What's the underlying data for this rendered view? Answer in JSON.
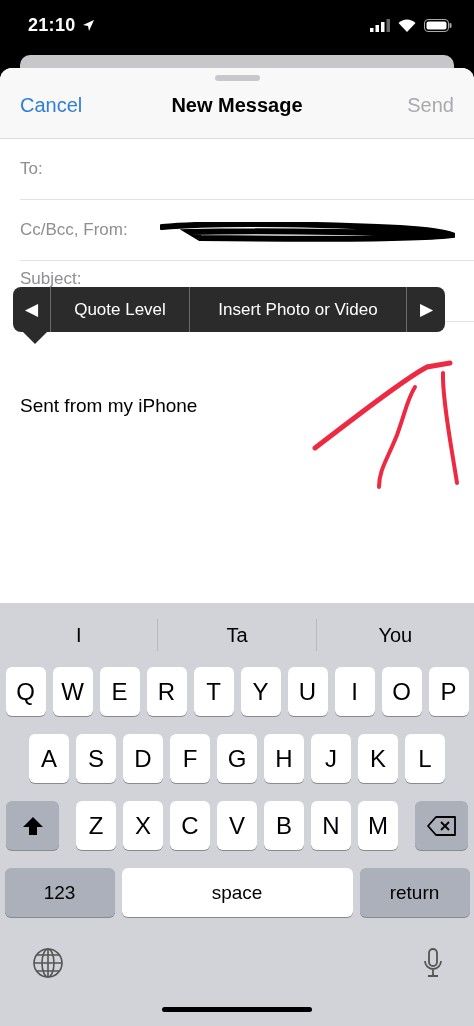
{
  "status_bar": {
    "time": "21:10"
  },
  "nav": {
    "cancel": "Cancel",
    "title": "New Message",
    "send": "Send",
    "send_disabled": true
  },
  "fields": [
    {
      "label": "To:"
    },
    {
      "label": "Cc/Bcc, From:",
      "redacted": true
    },
    {
      "label": "Subject:"
    }
  ],
  "edit_menu": {
    "items": [
      {
        "kind": "prev",
        "label": "◀"
      },
      {
        "kind": "item",
        "label": "Quote Level"
      },
      {
        "kind": "item",
        "label": "Insert Photo or Video"
      },
      {
        "kind": "next",
        "label": "▶"
      }
    ]
  },
  "body": "Sent from my iPhone",
  "keyboard": {
    "suggestions": [
      "I",
      "Ta",
      "You"
    ],
    "rows": [
      [
        {
          "kind": "letter",
          "label": "Q"
        },
        {
          "kind": "letter",
          "label": "W"
        },
        {
          "kind": "letter",
          "label": "E"
        },
        {
          "kind": "letter",
          "label": "R"
        },
        {
          "kind": "letter",
          "label": "T"
        },
        {
          "kind": "letter",
          "label": "Y"
        },
        {
          "kind": "letter",
          "label": "U"
        },
        {
          "kind": "letter",
          "label": "I"
        },
        {
          "kind": "letter",
          "label": "O"
        },
        {
          "kind": "letter",
          "label": "P"
        }
      ],
      [
        {
          "kind": "letter",
          "label": "A"
        },
        {
          "kind": "letter",
          "label": "S"
        },
        {
          "kind": "letter",
          "label": "D"
        },
        {
          "kind": "letter",
          "label": "F"
        },
        {
          "kind": "letter",
          "label": "G"
        },
        {
          "kind": "letter",
          "label": "H"
        },
        {
          "kind": "letter",
          "label": "J"
        },
        {
          "kind": "letter",
          "label": "K"
        },
        {
          "kind": "letter",
          "label": "L"
        }
      ],
      [
        {
          "kind": "shift"
        },
        {
          "kind": "letter",
          "label": "Z"
        },
        {
          "kind": "letter",
          "label": "X"
        },
        {
          "kind": "letter",
          "label": "C"
        },
        {
          "kind": "letter",
          "label": "V"
        },
        {
          "kind": "letter",
          "label": "B"
        },
        {
          "kind": "letter",
          "label": "N"
        },
        {
          "kind": "letter",
          "label": "M"
        },
        {
          "kind": "delete"
        }
      ]
    ],
    "bottom_row": {
      "numbers": "123",
      "space": "space",
      "return": "return"
    }
  }
}
